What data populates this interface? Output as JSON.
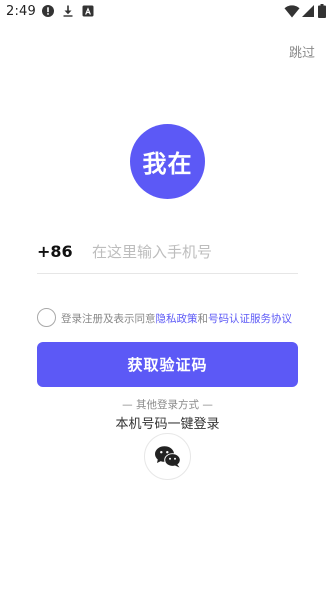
{
  "status_bar": {
    "time": "2:49",
    "icons": [
      "alert-icon",
      "download-icon",
      "a-icon",
      "wifi-icon",
      "signal-icon",
      "battery-icon"
    ]
  },
  "header": {
    "skip_label": "跳过"
  },
  "logo": {
    "text": "我在",
    "color": "#5c59f6"
  },
  "phone": {
    "country_code": "+86",
    "placeholder": "在这里输入手机号",
    "value": ""
  },
  "agreement": {
    "prefix": "登录注册及表示同意",
    "privacy_link": "隐私政策",
    "and": "和",
    "service_link": "号码认证服务协议",
    "checked": false
  },
  "primary_button": {
    "label": "获取验证码"
  },
  "other_login": {
    "title": "— 其他登录方式 —",
    "one_key": "本机号码一键登录",
    "wechat_icon": "wechat-icon"
  },
  "colors": {
    "accent": "#5c59f6",
    "muted": "#8a8a8a",
    "divider": "#e6e6e6"
  }
}
